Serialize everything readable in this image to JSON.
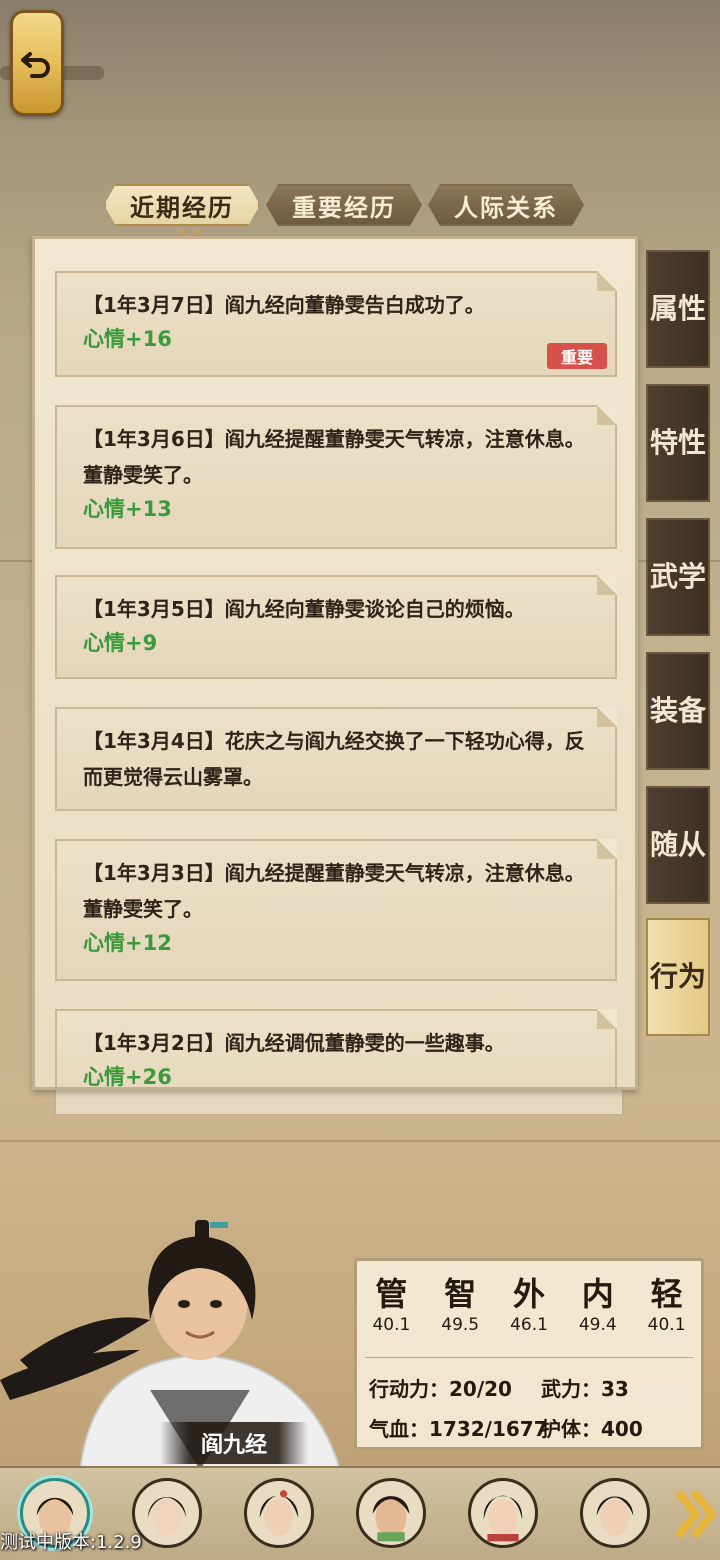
{
  "tabs": [
    {
      "label": "近期经历",
      "active": true
    },
    {
      "label": "重要经历",
      "active": false
    },
    {
      "label": "人际关系",
      "active": false
    }
  ],
  "entries": [
    {
      "line": "【1年3月7日】阎九经向董静雯告白成功了。",
      "mood": "心情+16",
      "badge": "重要"
    },
    {
      "line": "【1年3月6日】阎九经提醒董静雯天气转凉，注意休息。董静雯笑了。",
      "mood": "心情+13"
    },
    {
      "line": "【1年3月5日】阎九经向董静雯谈论自己的烦恼。",
      "mood": "心情+9"
    },
    {
      "line": "【1年3月4日】花庆之与阎九经交换了一下轻功心得，反而更觉得云山雾罩。",
      "mood": ""
    },
    {
      "line": "【1年3月3日】阎九经提醒董静雯天气转凉，注意休息。董静雯笑了。",
      "mood": "心情+12"
    },
    {
      "line": "【1年3月2日】阎九经调侃董静雯的一些趣事。",
      "mood": "心情+26"
    }
  ],
  "side_tabs": [
    {
      "label": "属性",
      "active": false
    },
    {
      "label": "特性",
      "active": false
    },
    {
      "label": "武学",
      "active": false
    },
    {
      "label": "装备",
      "active": false
    },
    {
      "label": "随从",
      "active": false
    },
    {
      "label": "行为",
      "active": true
    }
  ],
  "attributes": [
    {
      "name": "管",
      "value": "40.1"
    },
    {
      "name": "智",
      "value": "49.5"
    },
    {
      "name": "外",
      "value": "46.1"
    },
    {
      "name": "内",
      "value": "49.4"
    },
    {
      "name": "轻",
      "value": "40.1"
    }
  ],
  "stats": {
    "action": "行动力：20/20",
    "force": "武力：33",
    "hp": "气血：1732/1677",
    "guard": "护体：400"
  },
  "character": {
    "name": "阎九经"
  },
  "version": "测试中版本:1.2.9",
  "icons": [
    "back-arrow-icon",
    "next-arrow-icon"
  ],
  "colors": {
    "mood_green": "#3c9a3c",
    "badge_red": "#d6514a",
    "active_tab": "#e8d3a3"
  }
}
